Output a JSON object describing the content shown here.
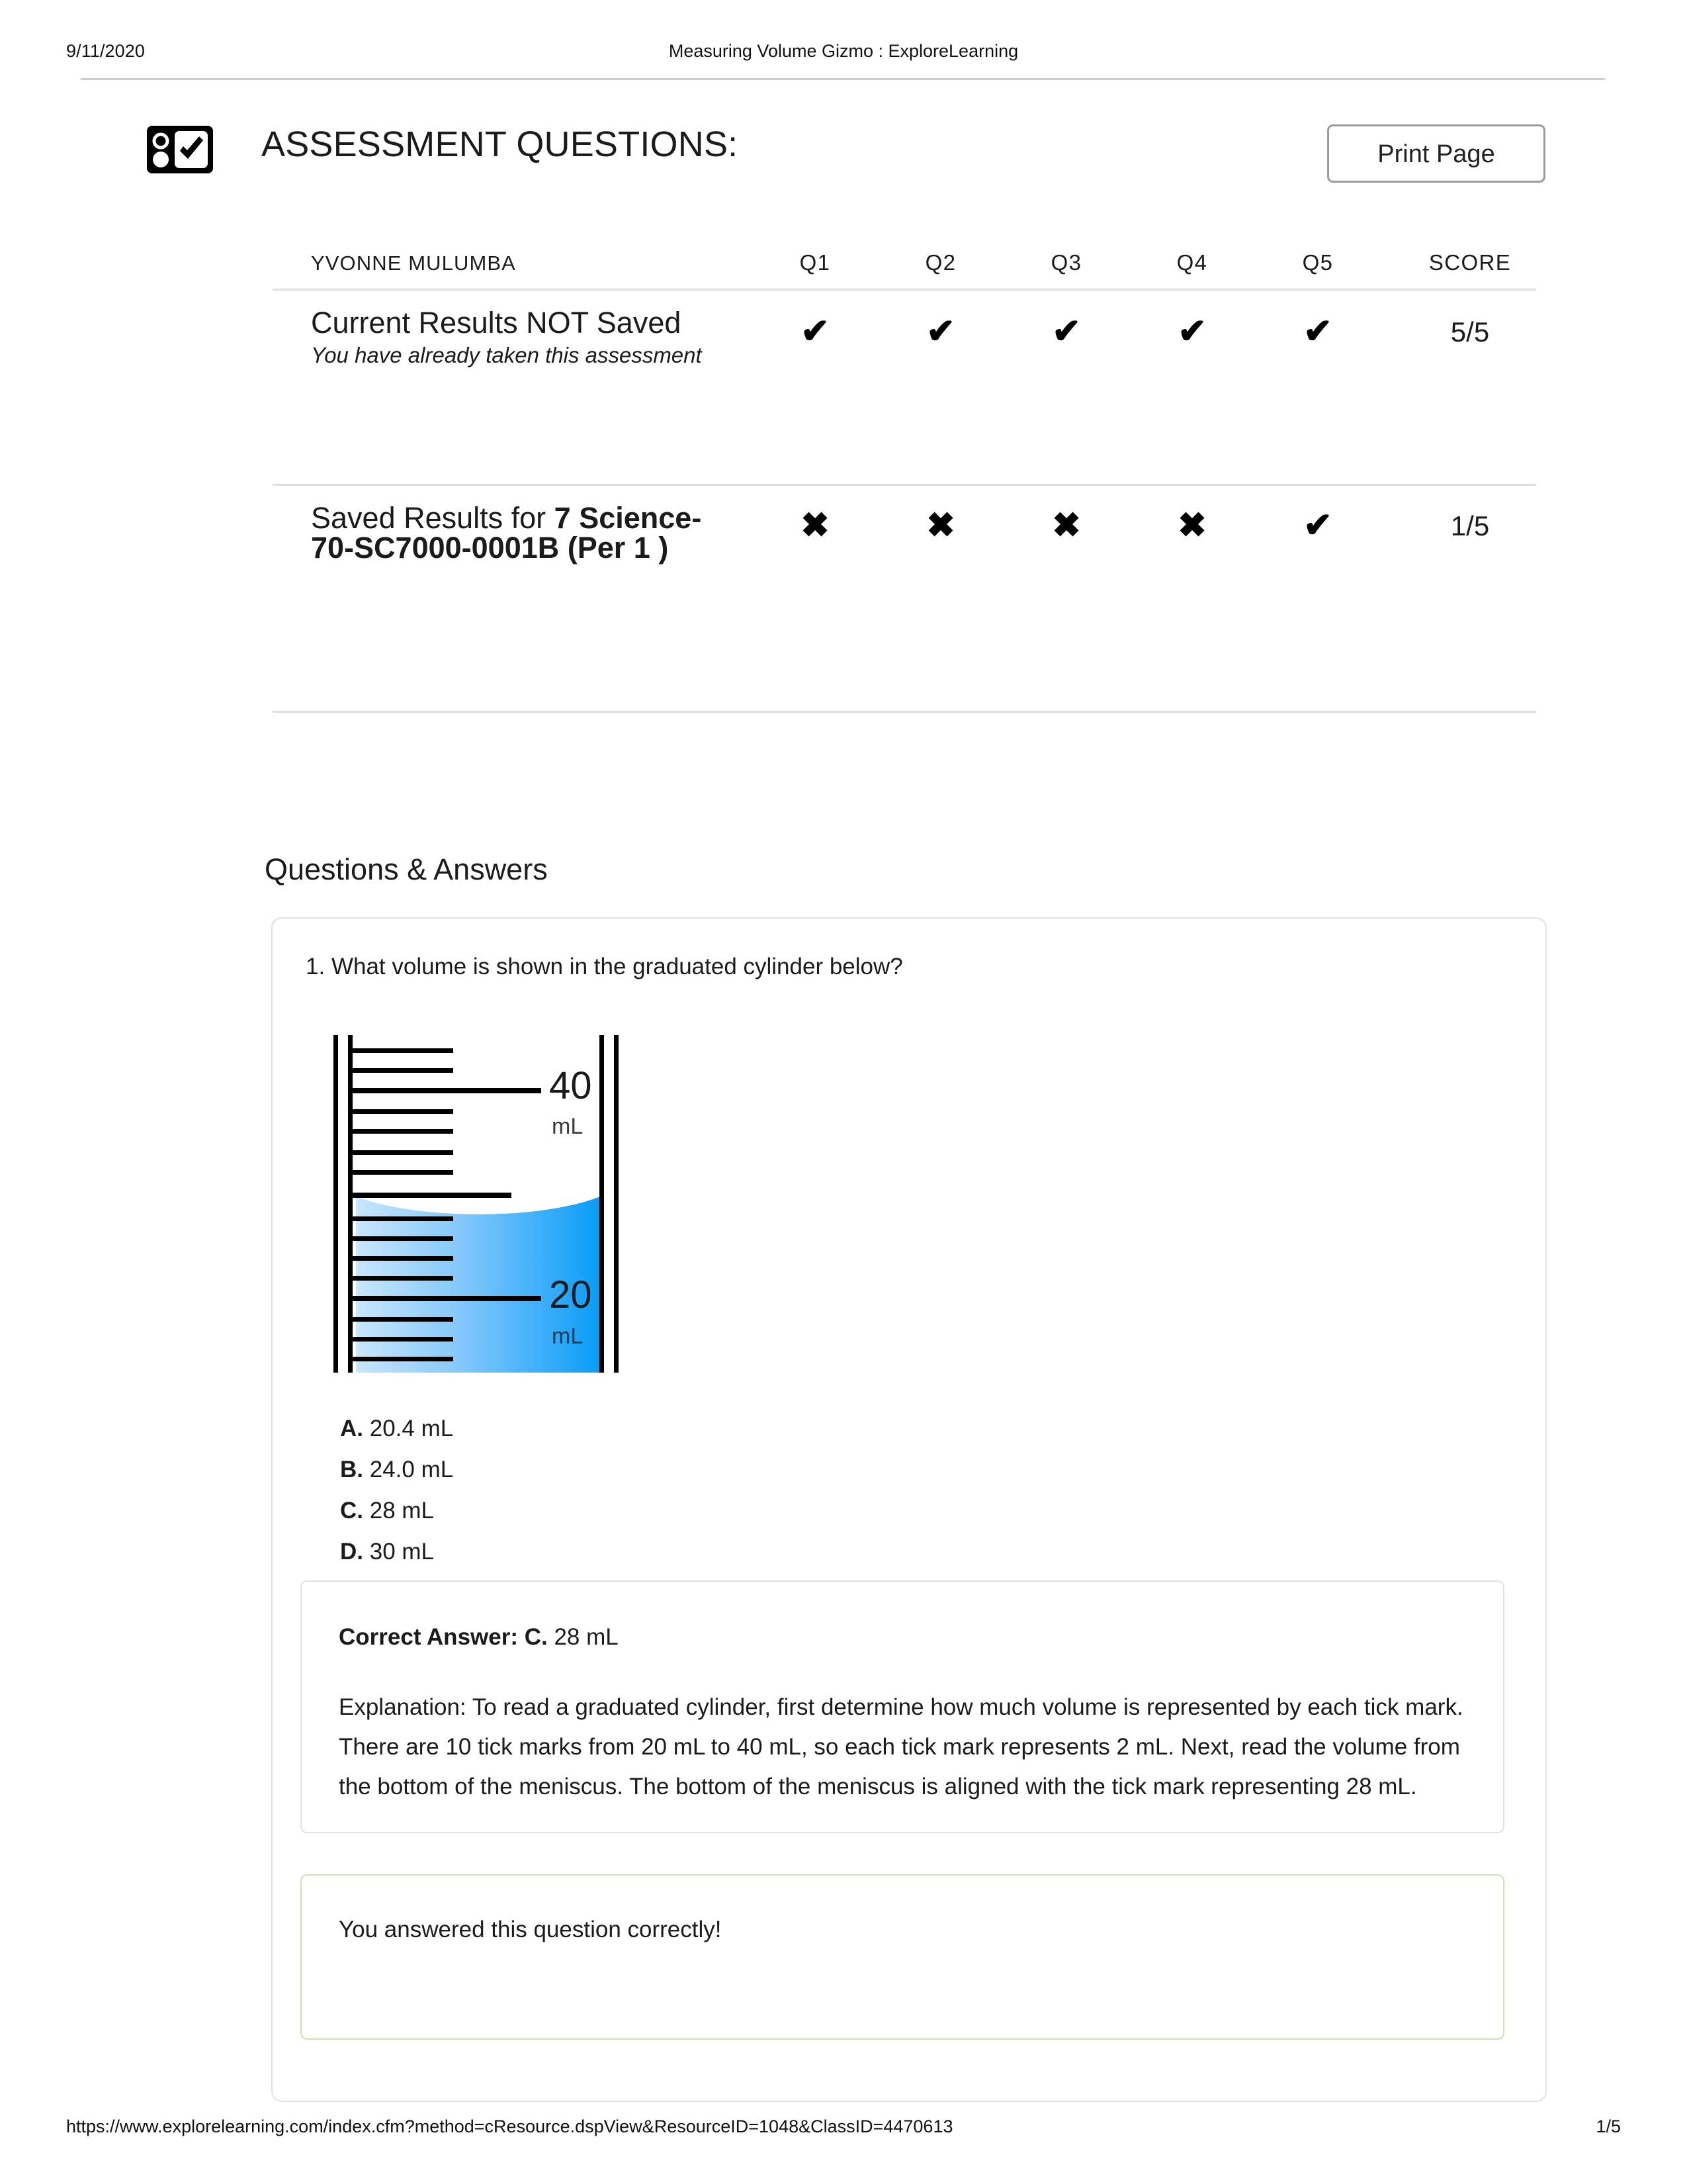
{
  "print_header": {
    "date": "9/11/2020",
    "title": "Measuring Volume Gizmo : ExploreLearning"
  },
  "page_title": "ASSESSMENT QUESTIONS:",
  "print_button": "Print Page",
  "results_table": {
    "student_name": "YVONNE MULUMBA",
    "columns": [
      "Q1",
      "Q2",
      "Q3",
      "Q4",
      "Q5"
    ],
    "score_column": "SCORE",
    "rows": [
      {
        "label_main": "Current Results NOT Saved",
        "label_note": "You have already taken this assessment",
        "marks": [
          "check",
          "check",
          "check",
          "check",
          "check"
        ],
        "score": "5/5"
      },
      {
        "label_prefix": "Saved Results for ",
        "label_bold": "7 Science-70-SC7000-0001B (Per 1 )",
        "marks": [
          "cross",
          "cross",
          "cross",
          "cross",
          "check"
        ],
        "score": "1/5"
      }
    ]
  },
  "qa_heading": "Questions & Answers",
  "question": {
    "number": "1.",
    "prompt": "What volume is shown in the graduated cylinder below?",
    "cylinder": {
      "label_top_value": "40",
      "label_top_unit": "mL",
      "label_bottom_value": "20",
      "label_bottom_unit": "mL",
      "liquid_color_light": "#bfe0fb",
      "liquid_color_dark": "#0a9cf5"
    },
    "options": [
      {
        "letter": "A.",
        "text": "20.4 mL"
      },
      {
        "letter": "B.",
        "text": "24.0 mL"
      },
      {
        "letter": "C.",
        "text": "28 mL"
      },
      {
        "letter": "D.",
        "text": "30 mL"
      }
    ],
    "explanation": {
      "answer_label": "Correct Answer: C.",
      "answer_value": "28 mL",
      "body": "Explanation: To read a graduated cylinder, first determine how much volume is represented by each tick mark. There are 10 tick marks from 20 mL to 40 mL, so each tick mark represents 2 mL. Next, read the volume from the bottom of the meniscus. The bottom of the meniscus is aligned with the tick mark representing 28 mL."
    },
    "feedback": "You answered this question correctly!",
    "feedback_border_color": "#cbe2b7"
  },
  "print_footer": {
    "url": "https://www.explorelearning.com/index.cfm?method=cResource.dspView&ResourceID=1048&ClassID=4470613",
    "page": "1/5"
  },
  "icons": {
    "assessment": "assessment-checkbox-icon"
  }
}
